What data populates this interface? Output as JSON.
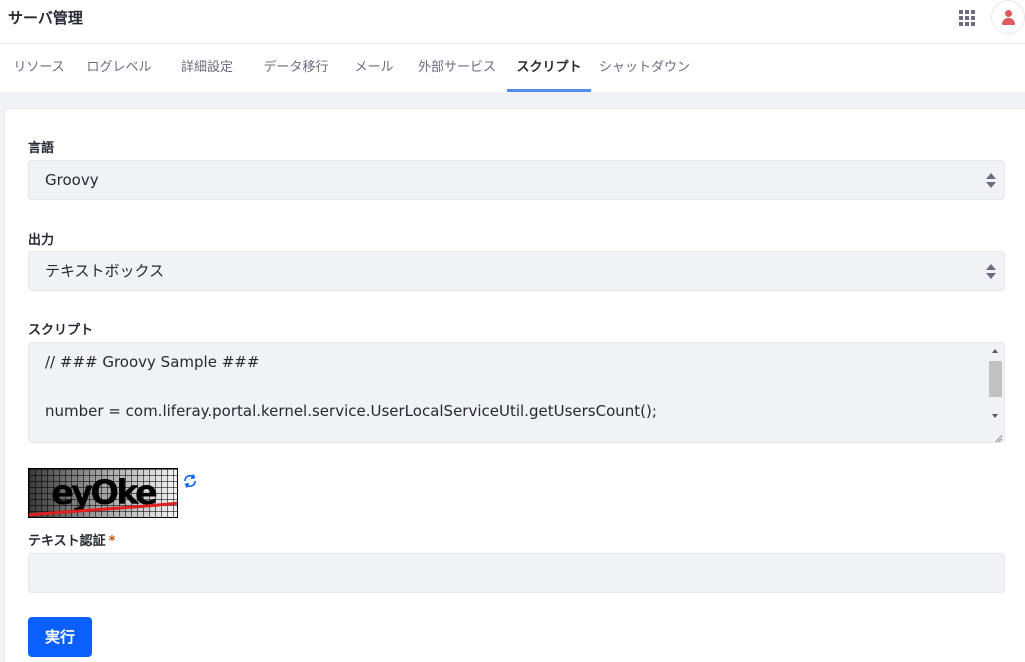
{
  "header": {
    "title": "サーバ管理",
    "apps_icon": "apps-grid-icon",
    "user_icon": "user-avatar-icon"
  },
  "tabs": [
    {
      "label": "リソース",
      "active": false
    },
    {
      "label": "ログレベル",
      "active": false
    },
    {
      "label": "詳細設定",
      "active": false
    },
    {
      "label": "データ移行",
      "active": false
    },
    {
      "label": "メール",
      "active": false
    },
    {
      "label": "外部サービス",
      "active": false
    },
    {
      "label": "スクリプト",
      "active": true
    },
    {
      "label": "シャットダウン",
      "active": false
    }
  ],
  "form": {
    "language": {
      "label": "言語",
      "value": "Groovy"
    },
    "output": {
      "label": "出力",
      "value": "テキストボックス"
    },
    "script": {
      "label": "スクリプト",
      "lines": [
        "// ### Groovy Sample ###",
        "",
        "number = com.liferay.portal.kernel.service.UserLocalServiceUtil.getUsersCount();"
      ]
    },
    "captcha": {
      "text": "eyOke",
      "refresh_icon": "refresh-icon"
    },
    "text_verification": {
      "label": "テキスト認証",
      "required_mark": "*",
      "value": ""
    },
    "submit_label": "実行"
  },
  "colors": {
    "accent": "#528eef",
    "primary_button": "#0b5fff",
    "required": "#b95000",
    "avatar": "#e05a5a",
    "captcha_stroke": "#e0201e"
  }
}
